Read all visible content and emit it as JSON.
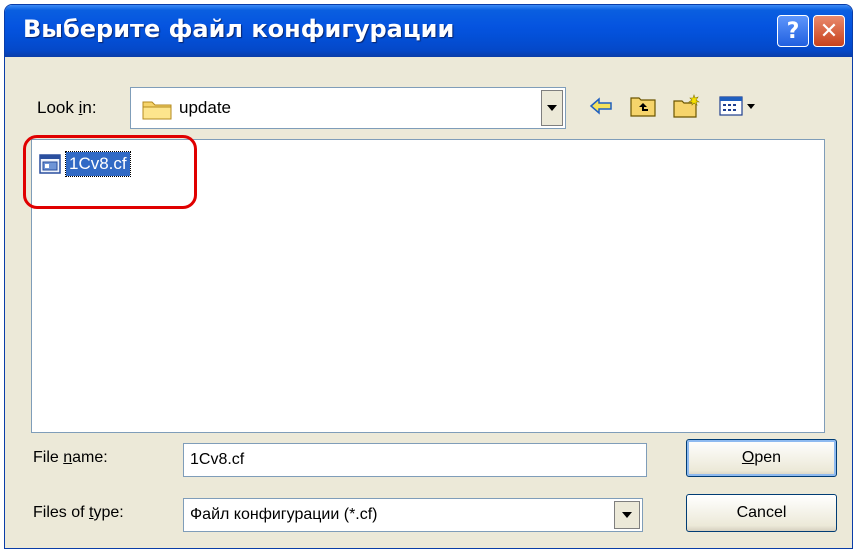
{
  "dialog": {
    "title": "Выберите файл конфигурации",
    "help_glyph": "?",
    "close_glyph": "✕"
  },
  "lookin": {
    "label_prefix": "Look ",
    "label_accel": "i",
    "label_suffix": "n:",
    "value": "update",
    "folder_icon": "folder-icon"
  },
  "toolbar": {
    "icons": [
      "back-arrow-icon",
      "up-folder-icon",
      "new-folder-icon",
      "view-menu-icon"
    ]
  },
  "files": [
    {
      "name": "1Cv8.cf",
      "icon": "config-file-icon",
      "selected": true
    }
  ],
  "filename": {
    "label_prefix": "File ",
    "label_accel": "n",
    "label_suffix": "ame:",
    "value": "1Cv8.cf"
  },
  "filetype": {
    "label_prefix": "Files of ",
    "label_accel": "t",
    "label_suffix": "ype:",
    "value": "Файл конфигурации (*.cf)"
  },
  "buttons": {
    "open_accel": "O",
    "open_rest": "pen",
    "cancel": "Cancel"
  },
  "colors": {
    "titlebar": "#0554e0",
    "selection": "#316ac5",
    "highlight_ring": "#e00000"
  }
}
